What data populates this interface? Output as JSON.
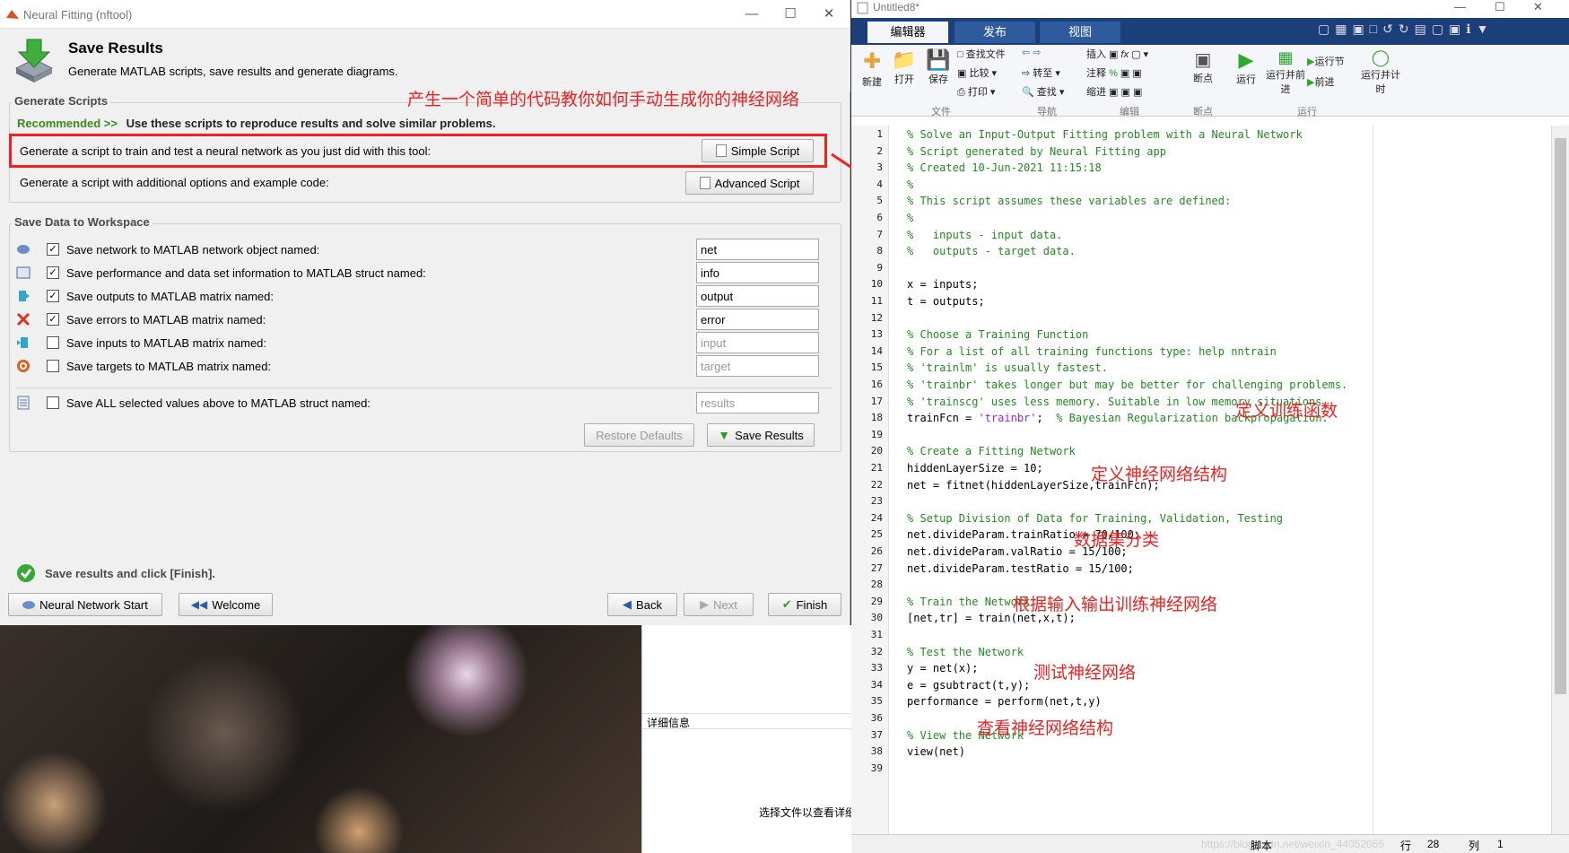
{
  "nftool": {
    "title": "Neural Fitting (nftool)",
    "header": {
      "title": "Save Results",
      "subtitle": "Generate MATLAB scripts, save results and generate diagrams."
    },
    "generate": {
      "group_title": "Generate Scripts",
      "recommended_label": "Recommended >>",
      "recommended_text": "Use these scripts to reproduce results and solve similar problems.",
      "simple_text": "Generate a script to train and test a neural network as you just did with this tool:",
      "simple_button": "Simple Script",
      "advanced_text": "Generate a script with additional options and example code:",
      "advanced_button": "Advanced Script"
    },
    "save": {
      "group_title": "Save Data to Workspace",
      "rows": [
        {
          "label": "Save network to MATLAB network object named:",
          "checked": true,
          "value": "net",
          "icon": "network-icon"
        },
        {
          "label": "Save performance and data set information to MATLAB struct named:",
          "checked": true,
          "value": "info",
          "icon": "struct-icon"
        },
        {
          "label": "Save outputs to MATLAB matrix named:",
          "checked": true,
          "value": "output",
          "icon": "outputs-icon"
        },
        {
          "label": "Save errors to MATLAB matrix named:",
          "checked": true,
          "value": "error",
          "icon": "errors-icon"
        },
        {
          "label": "Save inputs to MATLAB matrix named:",
          "checked": false,
          "value": "input",
          "icon": "inputs-icon"
        },
        {
          "label": "Save targets to MATLAB matrix named:",
          "checked": false,
          "value": "target",
          "icon": "targets-icon"
        }
      ],
      "all_label": "Save ALL selected values above to MATLAB struct named:",
      "all_value": "results",
      "restore_button": "Restore Defaults",
      "save_button": "Save Results"
    },
    "status": "Save results and click [Finish].",
    "footer": {
      "nn_start": "Neural Network Start",
      "welcome": "Welcome",
      "back": "Back",
      "next": "Next",
      "finish": "Finish"
    }
  },
  "annotations": {
    "top": "产生一个简单的代码教你如何手动生成你的神经网络",
    "train_fn": "定义训练函数",
    "structure": "定义神经网络结构",
    "division": "数据集分类",
    "train": "根据输入输出训练神经网络",
    "test": "测试神经网络",
    "view": "查看神经网络结构"
  },
  "explorer": {
    "details_label": "详细信息",
    "select_hint": "选择文件以查看详细"
  },
  "editor": {
    "title": "Untitled8*",
    "tabs": [
      "编辑器",
      "发布",
      "视图"
    ],
    "tools": {
      "new": "新建",
      "open": "打开",
      "save": "保存",
      "find_files": "查找文件",
      "compare": "比较",
      "print": "打印",
      "goto": "转至",
      "find": "查找",
      "insert": "插入",
      "comment": "注释",
      "indent": "缩进",
      "breakpoints": "断点",
      "run": "运行",
      "run_advance": "运行并前进",
      "run_section": "运行节",
      "advance": "前进",
      "run_time": "运行并计时"
    },
    "sections": [
      "文件",
      "导航",
      "编辑",
      "断点",
      "运行"
    ],
    "status": {
      "mode": "脚本",
      "row_label": "行",
      "row": "28",
      "col_label": "列",
      "col": "1",
      "watermark": "https://blog.csdn.net/weixin_44052055"
    },
    "lines": [
      "% Solve an Input-Output Fitting problem with a Neural Network",
      "% Script generated by Neural Fitting app",
      "% Created 10-Jun-2021 11:15:18",
      "%",
      "% This script assumes these variables are defined:",
      "%",
      "%   inputs - input data.",
      "%   outputs - target data.",
      "",
      "x = inputs;",
      "t = outputs;",
      "",
      "% Choose a Training Function",
      "% For a list of all training functions type: help nntrain",
      "% 'trainlm' is usually fastest.",
      "% 'trainbr' takes longer but may be better for challenging problems.",
      "% 'trainscg' uses less memory. Suitable in low memory situations.",
      "trainFcn = 'trainbr';  % Bayesian Regularization backpropagation.",
      "",
      "% Create a Fitting Network",
      "hiddenLayerSize = 10;",
      "net = fitnet(hiddenLayerSize,trainFcn);",
      "",
      "% Setup Division of Data for Training, Validation, Testing",
      "net.divideParam.trainRatio = 70/100;",
      "net.divideParam.valRatio = 15/100;",
      "net.divideParam.testRatio = 15/100;",
      "",
      "% Train the Network",
      "[net,tr] = train(net,x,t);",
      "",
      "% Test the Network",
      "y = net(x);",
      "e = gsubtract(t,y);",
      "performance = perform(net,t,y)",
      "",
      "% View the Network",
      "view(net)",
      ""
    ]
  }
}
